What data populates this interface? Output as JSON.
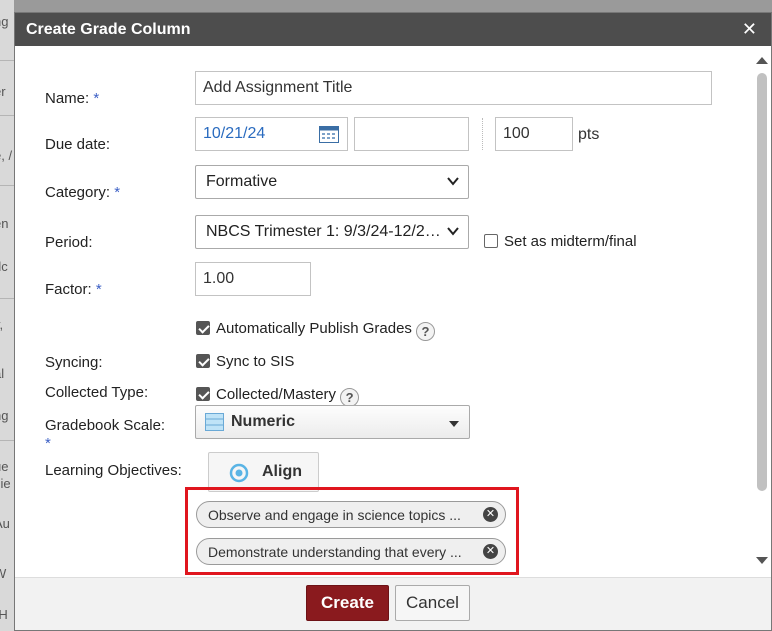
{
  "dialog": {
    "title": "Create Grade Column",
    "close_symbol": "✕"
  },
  "background_fragments": [
    "ng",
    "er",
    "e, /",
    "en",
    "dc",
    "y,",
    "al",
    "ng",
    "ue",
    "zie",
    "Au",
    "W",
    "-H"
  ],
  "form": {
    "name": {
      "label": "Name:",
      "required_mark": "*",
      "value": "Add Assignment Title"
    },
    "due_date": {
      "label": "Due date:",
      "date_value": "10/21/24",
      "time_value": "",
      "points_value": "100",
      "points_unit": "pts"
    },
    "category": {
      "label": "Category:",
      "required_mark": "*",
      "selected": "Formative"
    },
    "period": {
      "label": "Period:",
      "selected": "NBCS Trimester 1: 9/3/24-12/2…",
      "midterm_label": "Set as midterm/final",
      "midterm_checked": false
    },
    "factor": {
      "label": "Factor:",
      "required_mark": "*",
      "value": "1.00"
    },
    "auto_publish": {
      "label": "Automatically Publish Grades",
      "checked": true,
      "help": "?"
    },
    "syncing": {
      "label": "Syncing:",
      "option_label": "Sync to SIS",
      "checked": true
    },
    "collected_type": {
      "label": "Collected Type:",
      "option_label": "Collected/Mastery",
      "checked": true,
      "help": "?"
    },
    "gradebook_scale": {
      "label": "Gradebook Scale:",
      "required_mark": "*",
      "selected": "Numeric"
    },
    "learning_objectives": {
      "label": "Learning Objectives:",
      "align_label": "Align",
      "items": [
        {
          "text": "Observe and engage in science topics ..."
        },
        {
          "text": "Demonstrate understanding that every ..."
        }
      ]
    }
  },
  "footer": {
    "create_label": "Create",
    "cancel_label": "Cancel"
  },
  "colors": {
    "titlebar": "#4d4d4d",
    "primary_button": "#8a1a1e",
    "required_mark": "#3b5fc5",
    "date_text": "#2a6bbf",
    "highlight_border": "#e0161e"
  }
}
